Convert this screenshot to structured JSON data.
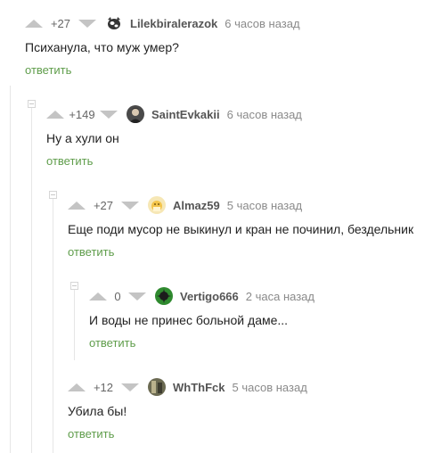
{
  "accent": {
    "reply_color": "#5f9d4b",
    "vote_arrow_color": "#c4c4c4"
  },
  "comments": [
    {
      "rating": "+27",
      "author": "Lilekbiralerazok",
      "time": "6 часов назад",
      "text": "Психанула, что муж умер?",
      "reply": "ответить",
      "avatar_icon": "cow-avatar-icon"
    },
    {
      "rating": "+149",
      "author": "SaintEvkakii",
      "time": "6 часов назад",
      "text": "Ну а хули он",
      "reply": "ответить",
      "avatar_icon": "portrait-avatar-icon"
    },
    {
      "rating": "+27",
      "author": "Almaz59",
      "time": "5 часов назад",
      "text": "Еще поди мусор не выкинул и кран не починил, бездельник",
      "reply": "ответить",
      "avatar_icon": "yellow-avatar-icon"
    },
    {
      "rating": "0",
      "author": "Vertigo666",
      "time": "2 часа назад",
      "text": "И воды не принес больной даме...",
      "reply": "ответить",
      "avatar_icon": "green-creature-avatar-icon"
    },
    {
      "rating": "+12",
      "author": "WhThFck",
      "time": "5 часов назад",
      "text": "Убила бы!",
      "reply": "ответить",
      "avatar_icon": "photo-avatar-icon"
    }
  ]
}
